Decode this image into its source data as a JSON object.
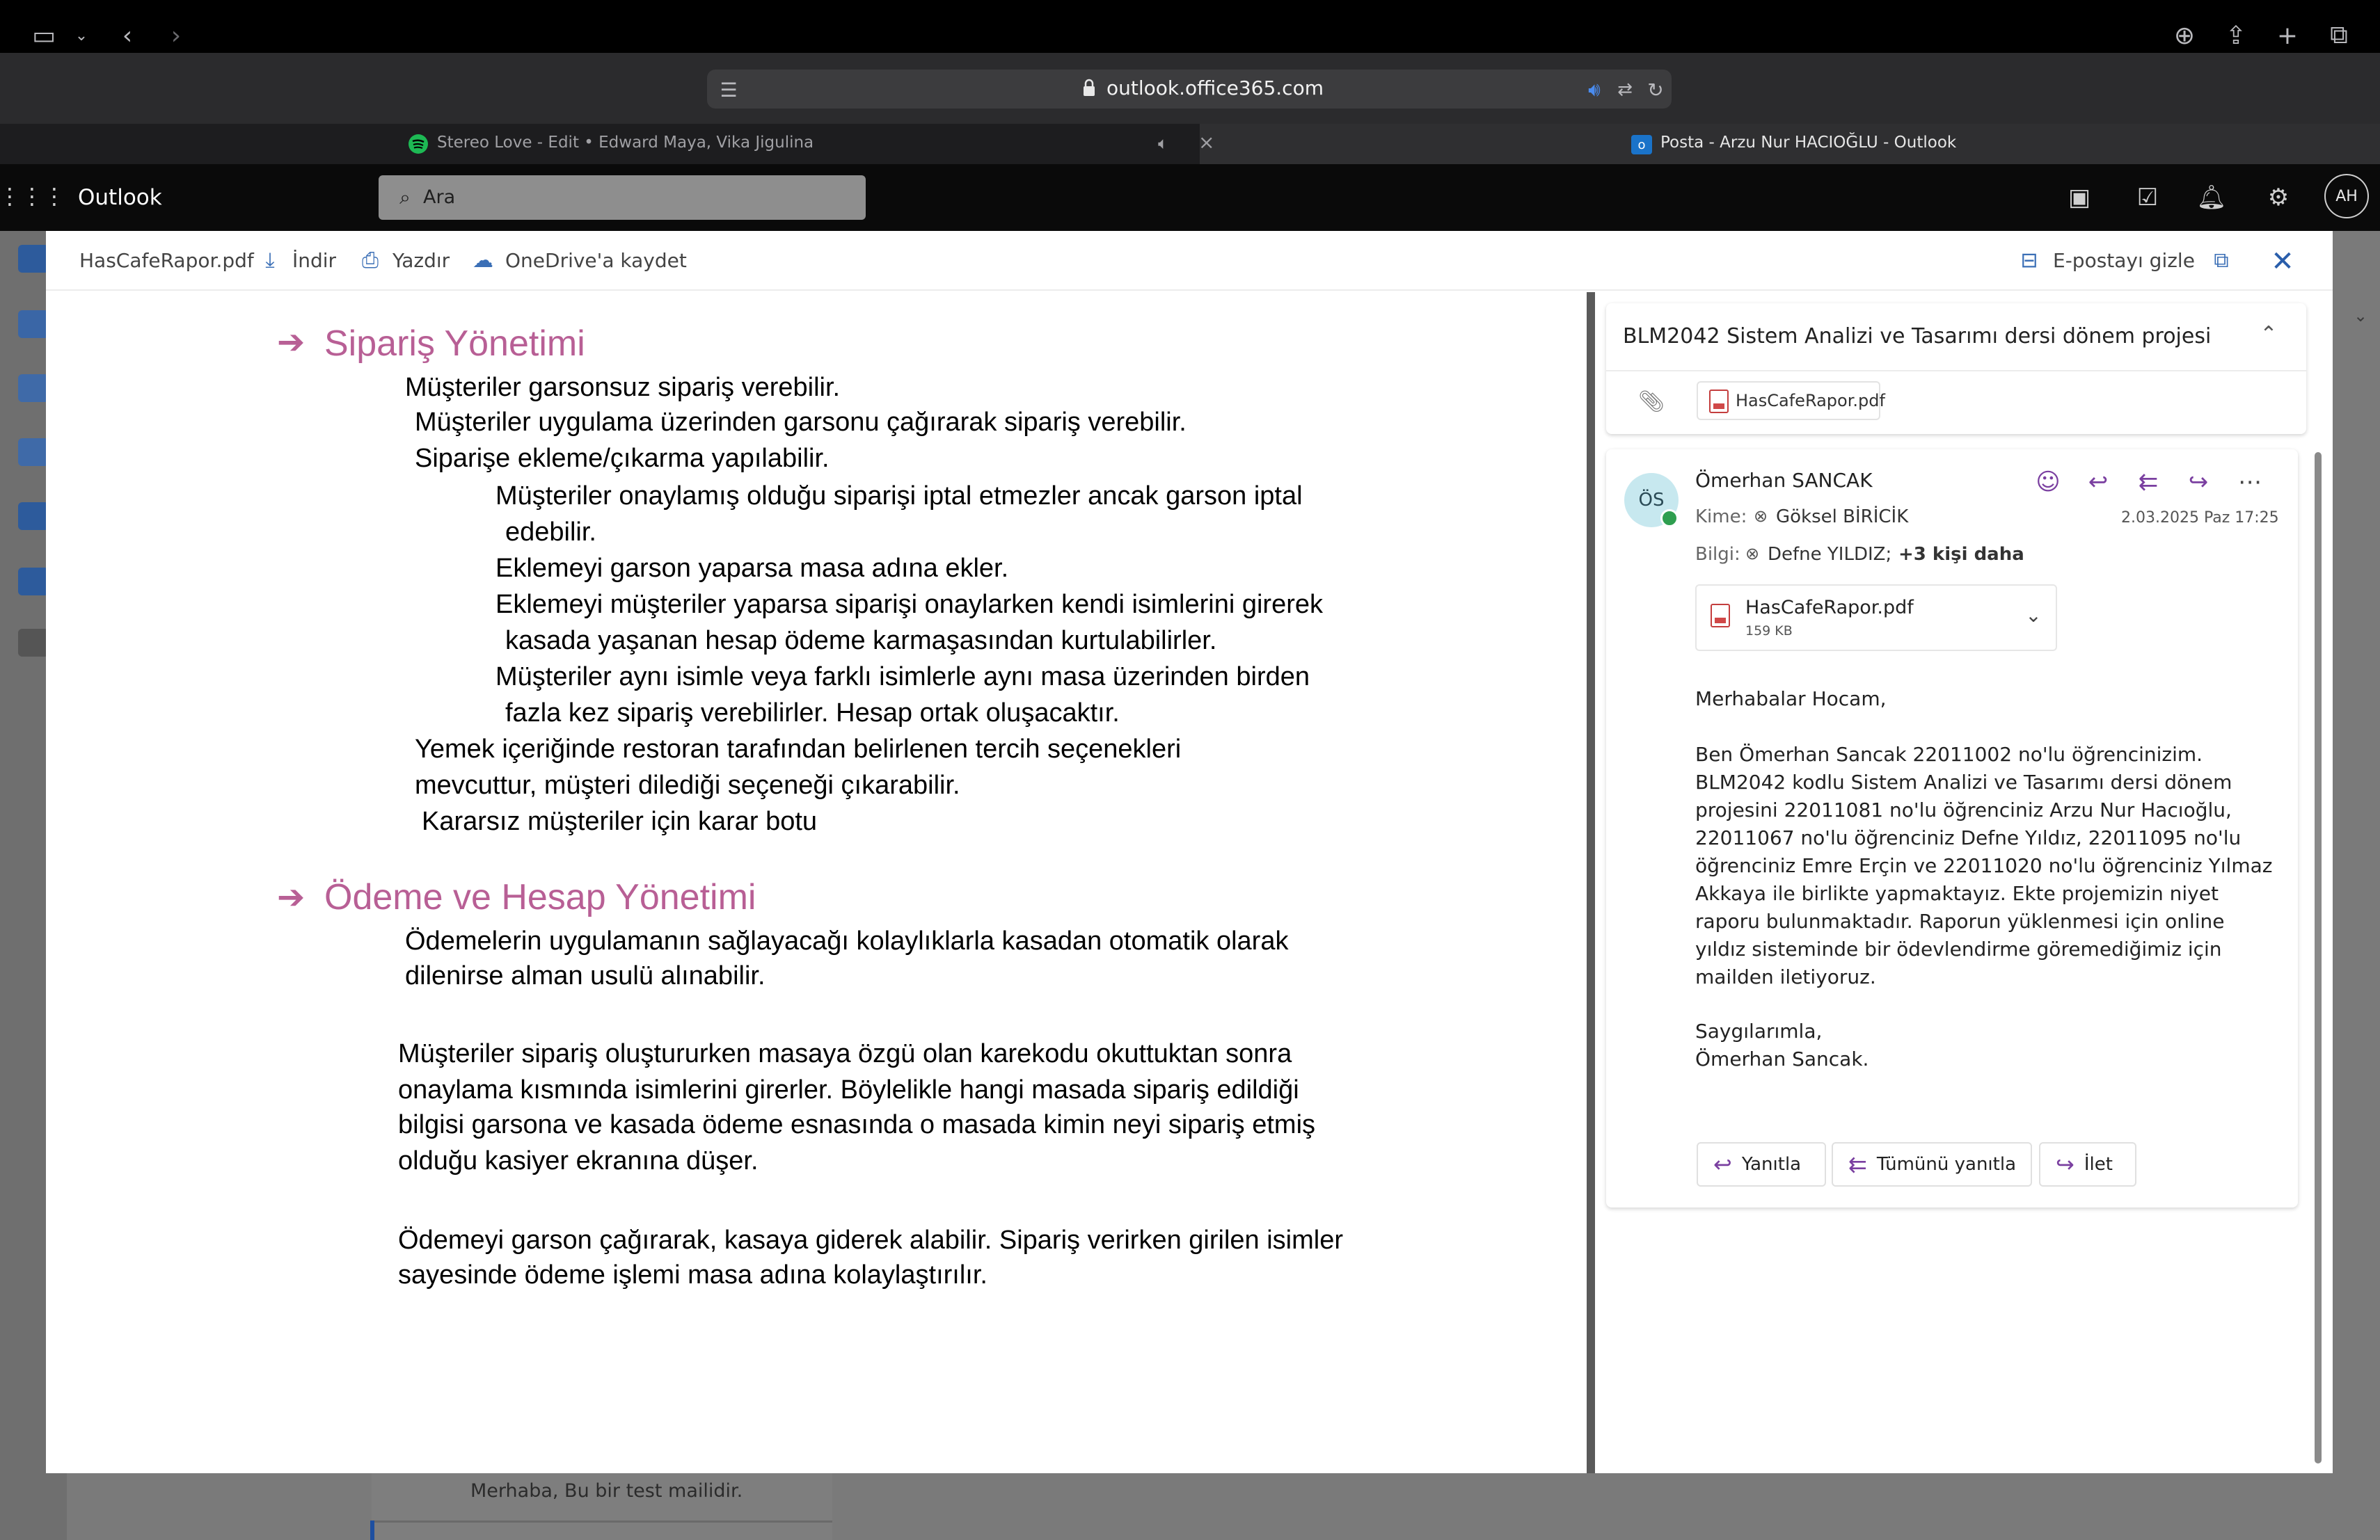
{
  "browser": {
    "url": "outlook.office365.com",
    "tabs": [
      {
        "label": "Stereo Love - Edit • Edward Maya, Vika Jigulina"
      },
      {
        "label": "Posta - Arzu Nur HACIOĞLU - Outlook"
      }
    ]
  },
  "outlook": {
    "app_title": "Outlook",
    "search_placeholder": "Ara",
    "avatar_initials": "AH"
  },
  "background": {
    "mail_snippet": "Merhaba, Bu bir test mailidir."
  },
  "viewer": {
    "file_name": "HasCafeRapor.pdf",
    "download_label": "İndir",
    "print_label": "Yazdır",
    "onedrive_label": "OneDrive'a kaydet",
    "hide_email_label": "E-postayı gizle"
  },
  "pdf": {
    "section1_title": "Sipariş Yönetimi",
    "section1_lines": [
      "Müşteriler garsonsuz sipariş verebilir.",
      "Müşteriler uygulama üzerinden garsonu çağırarak sipariş verebilir.",
      "Siparişe ekleme/çıkarma yapılabilir.",
      "Müşteriler onaylamış olduğu siparişi iptal etmezler ancak garson iptal",
      "edebilir.",
      "Eklemeyi garson yaparsa masa adına ekler.",
      "Eklemeyi müşteriler yaparsa siparişi onaylarken kendi isimlerini girerek",
      "kasada yaşanan hesap ödeme karmaşasından kurtulabilirler.",
      "Müşteriler aynı isimle veya farklı isimlerle aynı masa üzerinden birden",
      "fazla kez sipariş verebilirler. Hesap ortak oluşacaktır.",
      "Yemek içeriğinde restoran tarafından belirlenen tercih seçenekleri",
      "mevcuttur, müşteri dilediği seçeneği çıkarabilir.",
      "Kararsız müşteriler için karar botu"
    ],
    "section2_title": "Ödeme ve Hesap Yönetimi",
    "section2_lines": [
      "Ödemelerin uygulamanın sağlayacağı kolaylıklarla kasadan otomatik olarak",
      "dilenirse alman usulü alınabilir.",
      "Müşteriler sipariş oluştururken masaya özgü olan karekodu okuttuktan sonra",
      "onaylama kısmında isimlerini girerler. Böylelikle hangi masada sipariş edildiği",
      "bilgisi garsona ve kasada ödeme esnasında o masada kimin neyi sipariş etmiş",
      "olduğu kasiyer ekranına düşer.",
      "Ödemeyi garson çağırarak, kasaya giderek alabilir. Sipariş verirken girilen isimler",
      "sayesinde ödeme işlemi masa adına kolaylaştırılır."
    ]
  },
  "email": {
    "subject": "BLM2042 Sistem Analizi ve Tasarımı dersi dönem projesi",
    "attachment_chip": "HasCafeRapor.pdf",
    "sender_initials": "ÖS",
    "sender_name": "Ömerhan SANCAK",
    "to_label": "Kime:",
    "to_value": "Göksel BİRİCİK",
    "cc_label": "Bilgi:",
    "cc_value": "Defne YILDIZ;",
    "cc_more": "+3 kişi daha",
    "date": "2.03.2025 Paz 17:25",
    "attachment_name": "HasCafeRapor.pdf",
    "attachment_size": "159 KB",
    "greeting": "Merhabalar Hocam,",
    "body_lines": [
      "Ben Ömerhan Sancak 22011002 no'lu öğrencinizim.",
      "BLM2042 kodlu Sistem Analizi ve Tasarımı dersi dönem",
      "projesini 22011081 no'lu öğrenciniz Arzu Nur Hacıoğlu,",
      "22011067 no'lu öğrenciniz Defne Yıldız, 22011095 no'lu",
      "öğrenciniz Emre Erçin ve 22011020 no'lu öğrenciniz Yılmaz",
      "Akkaya ile birlikte yapmaktayız. Ekte projemizin niyet",
      "raporu bulunmaktadır. Raporun yüklenmesi için online",
      "yıldız sisteminde bir ödevlendirme göremediğimiz için",
      "mailden iletiyoruz."
    ],
    "closing": "Saygılarımla,",
    "signature": "Ömerhan Sancak.",
    "reply_label": "Yanıtla",
    "reply_all_label": "Tümünü yanıtla",
    "forward_label": "İlet"
  }
}
